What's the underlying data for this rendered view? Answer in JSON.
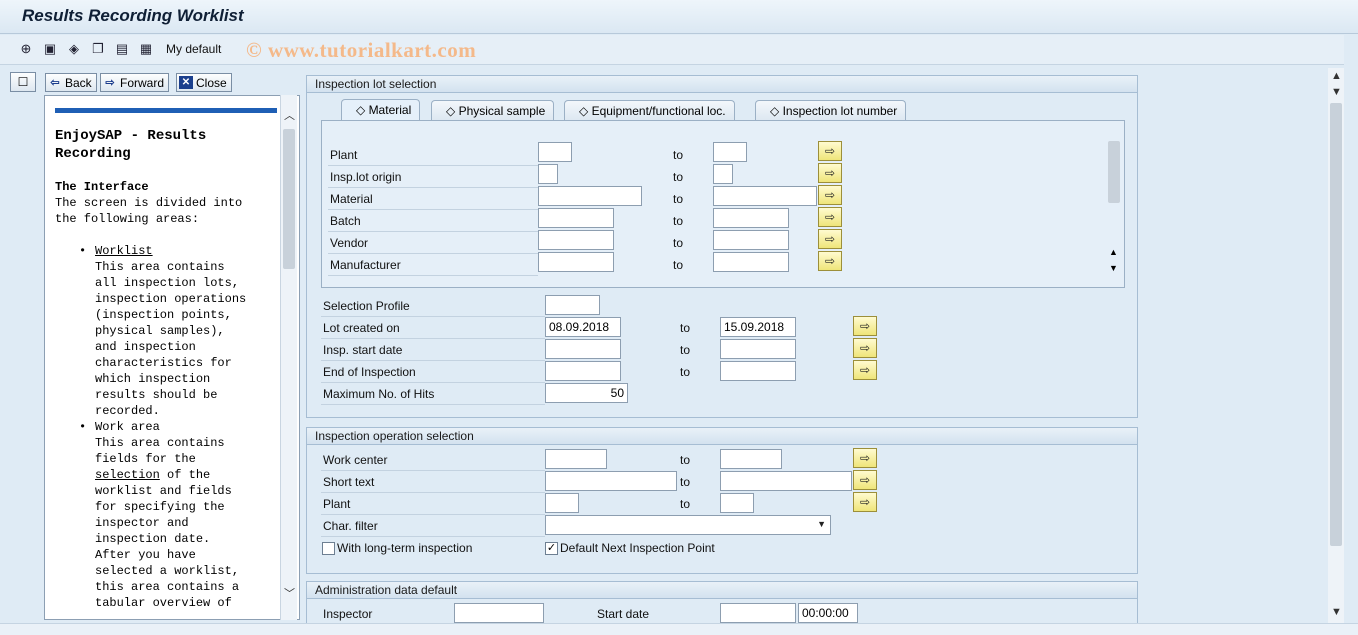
{
  "window": {
    "title": "Results Recording Worklist"
  },
  "toolbar": {
    "my_default": "My default",
    "watermark": "© www.tutorialkart.com"
  },
  "help": {
    "back": "Back",
    "forward": "Forward",
    "close": "Close",
    "title_line1": "EnjoySAP - Results",
    "title_line2": "Recording",
    "subtitle": "The Interface",
    "intro": [
      "The screen is divided into",
      "the following areas:"
    ],
    "item1_title": "Worklist",
    "item1_lines": [
      "This area contains",
      "all inspection lots,",
      "inspection operations",
      "(inspection points,",
      "physical samples),",
      "and inspection",
      "characteristics for",
      "which inspection",
      "results should be",
      "recorded."
    ],
    "item2_title": "Work area",
    "item2_line1": "This area contains",
    "item2_line2": "fields for the",
    "item2_sel": "selection",
    "item2_of_the": " of the",
    "item2_lines": [
      "worklist and fields",
      "for specifying the",
      "inspector and",
      "inspection date.",
      "After you have",
      "selected a worklist,",
      "this area contains a",
      "tabular overview of"
    ]
  },
  "lot_selection": {
    "header": "Inspection lot selection",
    "tabs": [
      "Material",
      "Physical sample",
      "Equipment/functional loc.",
      "Inspection lot number"
    ],
    "rows": [
      {
        "label": "Plant",
        "to": "to"
      },
      {
        "label": "Insp.lot origin",
        "to": "to"
      },
      {
        "label": "Material",
        "to": "to"
      },
      {
        "label": "Batch",
        "to": "to"
      },
      {
        "label": "Vendor",
        "to": "to"
      },
      {
        "label": "Manufacturer",
        "to": "to"
      }
    ],
    "selection_profile": "Selection Profile",
    "lot_created_on": "Lot created on",
    "lot_created_from": "08.09.2018",
    "lot_created_to": "15.09.2018",
    "insp_start_date": "Insp. start date",
    "end_of_inspection": "End of Inspection",
    "max_hits_label": "Maximum No. of Hits",
    "max_hits_value": "50",
    "to": "to"
  },
  "op_selection": {
    "header": "Inspection operation selection",
    "work_center": "Work center",
    "short_text": "Short text",
    "plant": "Plant",
    "char_filter": "Char. filter",
    "long_term": "With long-term inspection",
    "default_next": "Default Next Inspection Point",
    "default_next_checked": "✓",
    "to": "to"
  },
  "admin": {
    "header": "Administration data default",
    "inspector": "Inspector",
    "start_date": "Start date",
    "start_time": "00:00:00"
  }
}
